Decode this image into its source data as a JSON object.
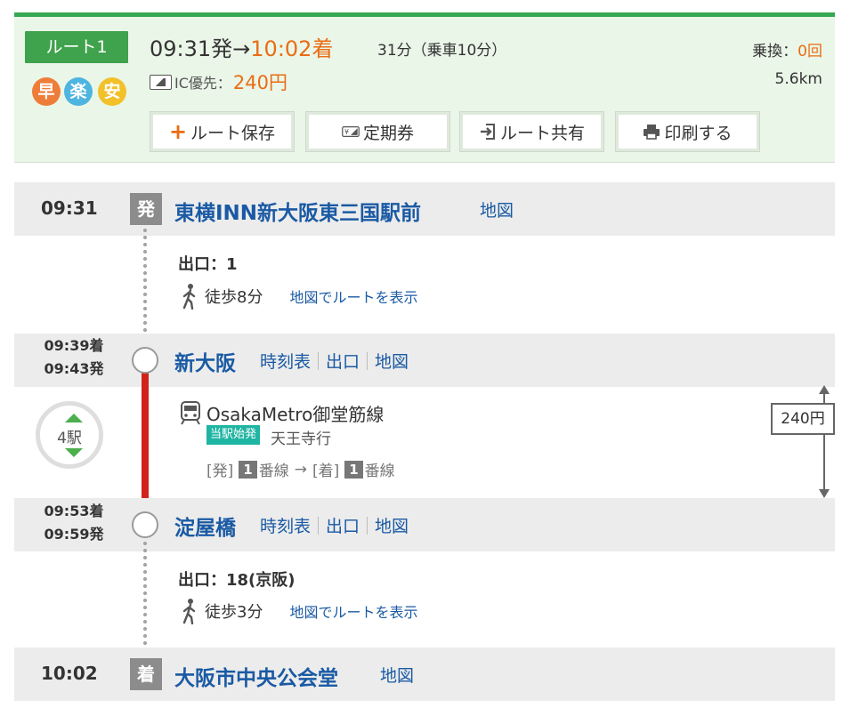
{
  "summary": {
    "route_label": "ルート1",
    "features": [
      "早",
      "楽",
      "安"
    ],
    "depart_time": "09:31発→",
    "arrive_time": "10:02着",
    "duration": "31分（乗車10分）",
    "fare_label": "IC優先：",
    "fare_amount": "240円",
    "transfer_label": "乗換：",
    "transfer_count": "0回",
    "distance": "5.6km",
    "buttons": {
      "save": "ルート保存",
      "pass": "定期券",
      "share": "ルート共有",
      "print": "印刷する"
    }
  },
  "segments": {
    "origin": {
      "time": "09:31",
      "mark": "発",
      "name": "東横INN新大阪東三国駅前",
      "map": "地図"
    },
    "walk1": {
      "exit": "出口：1",
      "walk": "徒歩8分",
      "link": "地図でルートを表示"
    },
    "shin_osaka": {
      "arr": "09:39着",
      "dep": "09:43発",
      "name": "新大阪",
      "timetable": "時刻表",
      "exit": "出口",
      "map": "地図"
    },
    "train": {
      "stops": "4駅",
      "line": "OsakaMetro御堂筋線",
      "badge": "当駅始発",
      "dest": "天王寺行",
      "dep_label": "[発]",
      "dep_track": "1",
      "track_unit": "番線",
      "arrow": "→",
      "arr_label": "[着]",
      "arr_track": "1",
      "fare": "240円"
    },
    "yodoyabashi": {
      "arr": "09:53着",
      "dep": "09:59発",
      "name": "淀屋橋",
      "timetable": "時刻表",
      "exit": "出口",
      "map": "地図"
    },
    "walk2": {
      "exit": "出口：18(京阪)",
      "walk": "徒歩3分",
      "link": "地図でルートを表示"
    },
    "destination": {
      "time": "10:02",
      "mark": "着",
      "name": "大阪市中央公会堂",
      "map": "地図"
    }
  },
  "colors": {
    "accent_green": "#3fa24c",
    "orange": "#ea6d13",
    "link_blue": "#1a5aa4",
    "line_red": "#d1231b",
    "badge_teal": "#1fb5a3"
  }
}
